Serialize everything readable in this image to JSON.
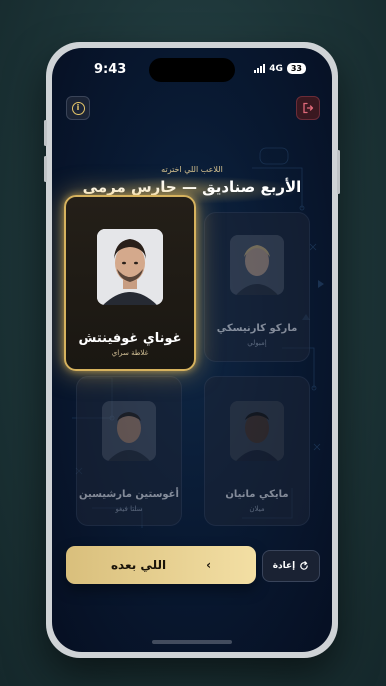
{
  "status": {
    "time": "9:43",
    "network": "4G",
    "battery": "33"
  },
  "header": {
    "subtitle": "اللاعب اللي اخترته",
    "title": "الأربع صناديق — حارس مرمى"
  },
  "cards": [
    {
      "name": "غوناي غوفينتش",
      "club": "غلاطة سراي",
      "selected": true
    },
    {
      "name": "ماركو كارنيسكي",
      "club": "إمبولي",
      "selected": false
    },
    {
      "name": "أغوستين مارشيسين",
      "club": "سلتا فيغو",
      "selected": false
    },
    {
      "name": "مايكي مانيان",
      "club": "ميلان",
      "selected": false
    }
  ],
  "buttons": {
    "next_label": "اللي بعده",
    "next_chevron": "‹",
    "reset_label": "إعادة"
  },
  "icons": {
    "info": "info-icon",
    "exit": "exit-icon",
    "reset": "refresh-icon"
  },
  "colors": {
    "gold": "#d6b25e",
    "background": "#091a33",
    "exit_accent": "#e06a7a"
  }
}
